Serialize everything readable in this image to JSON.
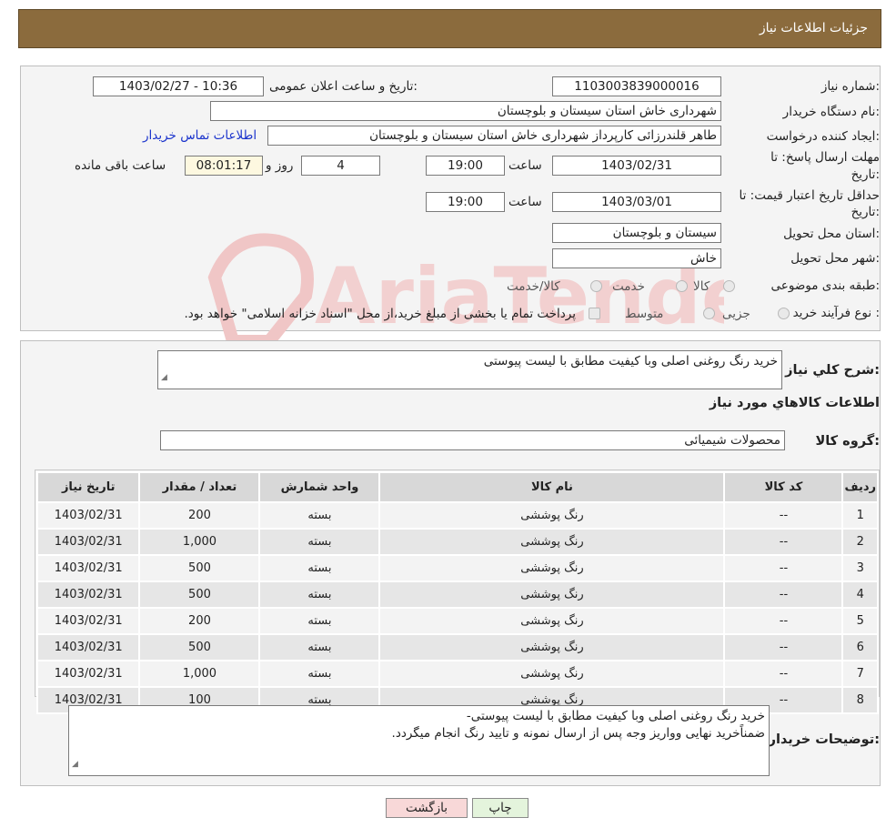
{
  "header": {
    "title": "جزئیات اطلاعات نیاز"
  },
  "form": {
    "need_number_label": "شماره نیاز:",
    "need_number": "1103003839000016",
    "announce_label": "تاریخ و ساعت اعلان عمومی:",
    "announce_value": "1403/02/27 - 10:36",
    "buyer_org_label": "نام دستگاه خریدار:",
    "buyer_org": "شهرداری خاش استان سیستان و بلوچستان",
    "creator_label": "ایجاد کننده درخواست:",
    "creator": "طاهر قلندرزائی کارپرداز شهرداری خاش استان سیستان و بلوچستان",
    "contact_link": "اطلاعات تماس خریدار",
    "reply_deadline_label_1": "مهلت ارسال پاسخ: تا",
    "reply_deadline_label_2": "تاریخ:",
    "reply_date": "1403/02/31",
    "time_label": "ساعت",
    "reply_time": "19:00",
    "days": "4",
    "days_label": "روز و",
    "remaining_time": "08:01:17",
    "remaining_label": "ساعت باقی مانده",
    "price_validity_label_1": "حداقل تاریخ اعتبار قیمت: تا",
    "price_validity_label_2": "تاریخ:",
    "price_date": "1403/03/01",
    "price_time": "19:00",
    "province_label": "استان محل تحویل:",
    "province": "سیستان و بلوچستان",
    "city_label": "شهر محل تحویل:",
    "city": "خاش",
    "category_label": "طبقه بندی موضوعی:",
    "category_options": [
      "کالا",
      "خدمت",
      "کالا/خدمت"
    ],
    "process_label": "نوع فرآیند خرید :",
    "process_options": [
      "جزیی",
      "متوسط"
    ],
    "process_note": "پرداخت تمام یا بخشی از مبلغ خرید،از محل \"اسناد خزانه اسلامی\" خواهد بود."
  },
  "details": {
    "summary_label": "شرح کلي نياز:",
    "summary": "خرید رنگ روغنی اصلی وبا کیفیت مطابق با لیست پیوستی",
    "goods_info_title": "اطلاعات کالاهاي مورد نياز",
    "goods_group_label": "گروه کالا:",
    "goods_group": "محصولات شیمیائی"
  },
  "table": {
    "columns": [
      "ردیف",
      "کد کالا",
      "نام کالا",
      "واحد شمارش",
      "تعداد / مقدار",
      "تاریخ نیاز"
    ],
    "rows": [
      [
        "1",
        "--",
        "رنگ پوششی",
        "بسته",
        "200",
        "1403/02/31"
      ],
      [
        "2",
        "--",
        "رنگ پوششی",
        "بسته",
        "1,000",
        "1403/02/31"
      ],
      [
        "3",
        "--",
        "رنگ پوششی",
        "بسته",
        "500",
        "1403/02/31"
      ],
      [
        "4",
        "--",
        "رنگ پوششی",
        "بسته",
        "500",
        "1403/02/31"
      ],
      [
        "5",
        "--",
        "رنگ پوششی",
        "بسته",
        "200",
        "1403/02/31"
      ],
      [
        "6",
        "--",
        "رنگ پوششی",
        "بسته",
        "500",
        "1403/02/31"
      ],
      [
        "7",
        "--",
        "رنگ پوششی",
        "بسته",
        "1,000",
        "1403/02/31"
      ],
      [
        "8",
        "--",
        "رنگ پوششی",
        "بسته",
        "100",
        "1403/02/31"
      ]
    ]
  },
  "buyer_notes": {
    "label": "توضیحات خریدار:",
    "line1": "خرید رنگ روغنی اصلی وبا کیفیت مطابق با لیست پیوستی-",
    "line2": "ضمناًخرید نهایی وواریز وجه پس از ارسال نمونه و تایید رنگ انجام میگردد."
  },
  "buttons": {
    "print": "چاپ",
    "back": "بازگشت"
  },
  "watermark": {
    "text": "AriaTender.neT"
  },
  "colors": {
    "header_bg": "#8b6b3d",
    "link": "#1a33cc",
    "back_button": "#f8d8d8",
    "print_button": "#e4f4dc"
  }
}
